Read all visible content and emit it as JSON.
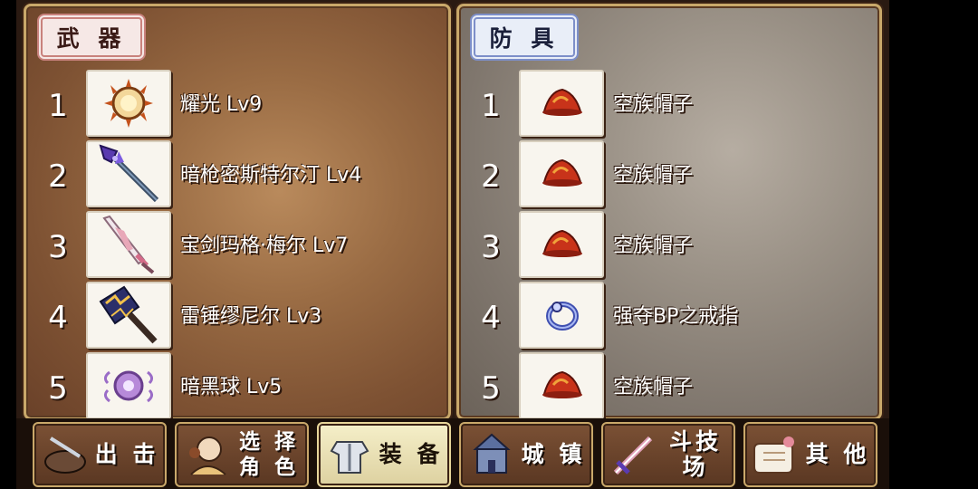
{
  "weapons": {
    "tab_label": "武 器",
    "items": [
      {
        "index": "1",
        "name": "耀光 Lv9",
        "icon": "sun-orb-icon"
      },
      {
        "index": "2",
        "name": "暗枪密斯特尔汀 Lv4",
        "icon": "dark-spear-icon"
      },
      {
        "index": "3",
        "name": "宝剑玛格·梅尔 Lv7",
        "icon": "sword-icon"
      },
      {
        "index": "4",
        "name": "雷锤缪尼尔 Lv3",
        "icon": "thunder-hammer-icon"
      },
      {
        "index": "5",
        "name": "暗黑球 Lv5",
        "icon": "dark-orb-icon"
      }
    ]
  },
  "armor": {
    "tab_label": "防 具",
    "items": [
      {
        "index": "1",
        "name": "空族帽子",
        "icon": "sky-hat-icon"
      },
      {
        "index": "2",
        "name": "空族帽子",
        "icon": "sky-hat-icon"
      },
      {
        "index": "3",
        "name": "空族帽子",
        "icon": "sky-hat-icon"
      },
      {
        "index": "4",
        "name": "强夺BP之戒指",
        "icon": "ring-icon"
      },
      {
        "index": "5",
        "name": "空族帽子",
        "icon": "sky-hat-icon"
      }
    ]
  },
  "menu": {
    "sortie": "出 击",
    "select_line1": "选 择",
    "select_line2": "角 色",
    "equip": "装 备",
    "town": "城 镇",
    "arena": "斗技场",
    "other": "其 他",
    "active": "equip"
  }
}
